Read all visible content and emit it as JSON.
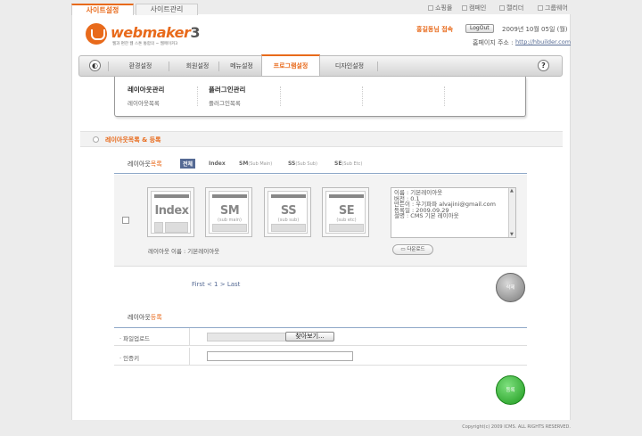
{
  "top_tabs": [
    "사이트설정",
    "사이트관리"
  ],
  "top_links": [
    "쇼핑몰",
    "캠페인",
    "캘리더",
    "그룹웨어"
  ],
  "logo": {
    "name": "webmaker",
    "version": "3",
    "tagline": "웹과 편한 웹 스톤 통합의 ~ 웹메이커3"
  },
  "header": {
    "user": "홍길동님 접속",
    "logout_label": "LogOut",
    "date": "2009년 10월 05일 (월)",
    "homepage_label": "홈페이지 주소 :",
    "homepage_url": "http://hbuilder.com"
  },
  "nav": {
    "items": [
      "환경설정",
      "회원설정",
      "메뉴설정",
      "프로그램설정",
      "디자인설정"
    ],
    "active": "프로그램설정",
    "help_icon": "?"
  },
  "submenu": {
    "groups": [
      {
        "title": "레이아웃관리",
        "link": "레이아웃목록"
      },
      {
        "title": "플러그인관리",
        "link": "플러그인목록"
      }
    ]
  },
  "section": {
    "title": "레이아웃목록 & 등록"
  },
  "list": {
    "tab_prefix": "레이아웃",
    "tab_suffix": "목록",
    "filters": [
      {
        "label": "전체",
        "sub": ""
      },
      {
        "label": "Index",
        "sub": ""
      },
      {
        "label": "SM",
        "sub": "(Sub Main)"
      },
      {
        "label": "SS",
        "sub": "(Sub Sub)"
      },
      {
        "label": "SE",
        "sub": "(Sub Etc)"
      }
    ],
    "thumbs": [
      {
        "big": "Index",
        "small": ""
      },
      {
        "big": "SM",
        "small": "(sub main)"
      },
      {
        "big": "SS",
        "small": "(sub sub)"
      },
      {
        "big": "SE",
        "small": "(sub etc)"
      }
    ],
    "layout_name": "레이아웃 이름 : 기본레이아웃",
    "info_lines": [
      "이름 : 기본레이아웃",
      "버전 : 0.1",
      "만든이 : 우기파파  alvajini@gmail.com",
      "등록일 : 2009.09.29",
      "설명 : CMS 기본 레이아웃"
    ],
    "download_label": "다운로드",
    "pager": "First  < 1 >  Last",
    "delete_label": "삭제"
  },
  "register": {
    "tab_prefix": "레이아웃",
    "tab_suffix": "등록",
    "file_label": "파일업로드",
    "browse_label": "찾아보기...",
    "id_label": "인증키",
    "submit_label": "등록"
  },
  "footer": {
    "copyright": "Copyright(c) 2009 ICMS. ALL RIGHTS RESERVED."
  },
  "colors": {
    "accent": "#e86a1b",
    "link": "#556a94",
    "submit": "#1e9a1e"
  }
}
